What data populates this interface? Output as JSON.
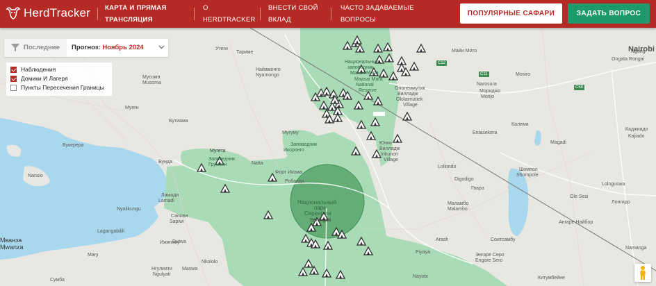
{
  "brand": {
    "name": "HerdTracker"
  },
  "nav": {
    "map_line1": "КАРТА И ПРЯМАЯ",
    "map_line2": "ТРАНСЛЯЦИЯ",
    "about_line1": "О",
    "about_line2": "HERDTRACKER",
    "contrib_line1": "ВНЕСТИ СВОЙ",
    "contrib_line2": "ВКЛАД",
    "faq_line1": "ЧАСТО ЗАДАВАЕМЫЕ",
    "faq_line2": "ВОПРОСЫ",
    "popular_button": "ПОПУЛЯРНЫЕ САФАРИ",
    "ask_button": "ЗАДАТЬ ВОПРОС"
  },
  "toolbar": {
    "recent_label": "Последние",
    "forecast_label": "Прогноз:",
    "forecast_value": "Ноябрь 2024"
  },
  "layers": [
    {
      "label": "Наблюдения",
      "checked": true
    },
    {
      "label": "Домики И Лагеря",
      "checked": true
    },
    {
      "label": "Пункты Пересечения Границы",
      "checked": false
    }
  ],
  "map_labels": {
    "utegi": "Утеги",
    "tarime": "Тариме",
    "nyamongo": "Найамонго",
    "nyamongo_en": "Nyamongo",
    "musoma": "Мусома",
    "musoma_en": "Musoma",
    "mugen": "Муген",
    "butiama": "Бутиама",
    "bukerera": "Букерера",
    "nansio": "Nansio",
    "bunda": "Бунда",
    "mugeta": "Мугета",
    "zapov_grumeti": "Заповедник",
    "grumeti": "Грумети",
    "natta": "Natta",
    "mugumu": "Мугуму",
    "zapov_ikorongo": "Заповедник",
    "ikorongo": "Икоронго",
    "fort_ikoma": "Форт Икома",
    "robanda": "Робанда",
    "masai_ru": "Национальный",
    "masai_ru2": "заповедник",
    "masai_ru3": "Масаи Мара",
    "masai_en": "Maasai Mara",
    "masai_en2": "National",
    "masai_en3": "Reserve",
    "olol_ru": "Олопеимутик",
    "olol_ru2": "Вилладж",
    "olol_en": "Ololaimutiek",
    "olol_en2": "Village",
    "mai_moto": "Майи Мото",
    "narosura": "Narosura",
    "morijo": "Мориджо",
    "morijo_en": "Morijo",
    "mosiro": "Mosiro",
    "entasekera": "Entasekera",
    "kalema": "Калема",
    "magadi": "Magadi",
    "nairobi": "Nairobi",
    "ngong": "Ngong",
    "ongata": "Ongata Rongai",
    "kajiado_ru": "Каджиадо",
    "kajiado": "Kajiado",
    "loliondo": "Loliondo",
    "shompole_ru": "Шомпол",
    "shompole": "Shompole",
    "digodigo": "Digodigo",
    "gwara": "Гвара",
    "lolnguswa": "Lolnguswa",
    "olesi": "Ole Sesi",
    "longido": "Лонгидо",
    "angare": "Ангаре Найбор",
    "malambo_ru": "Маламбо",
    "malambo": "Malambo",
    "lamadi": "Ламади",
    "lamadi_en": "Lamadi",
    "nyalikungu": "Nyalikungu",
    "sapiwi_ru": "Сапиви",
    "sapiwi": "Sapiwi",
    "lagangabilili": "Lagangabilili",
    "dutwa": "Dutwa",
    "mwanza": "Mwanza",
    "mary": "Mary",
    "busega": "Ижигиму",
    "nkololo": "Nkololo",
    "ngulyati_ru": "Нгулиати",
    "ngulyati": "Ngulyati",
    "sumba": "Сумба",
    "malya": "Маswa",
    "arash": "Arash",
    "piyaya": "Piyaya",
    "soitsambu": "Соитсамбу",
    "engaresero_ru": "Энгаре Серо",
    "engaresero": "Engare Sero",
    "nayobi": "Nayobi",
    "kitumbeine": "Китумбейне",
    "namanga": "Namanga",
    "serengeti_ru": "Национальный",
    "serengeti_ru2": "парк",
    "serengeti_ru3": "Серенгети",
    "serengeti_en": "Serengeti",
    "mwanza_ru": "Мванза",
    "yunki_ru": "Юнки",
    "yunki_ru2": "Вилладж",
    "yunki_en": "Inkunon",
    "yunki_en2": "Village",
    "kirumi": "Мвангена",
    "mbalageti": "Мбалагети",
    "kilimalutu": "Килима",
    "road_c12": "C12",
    "road_c11": "C11",
    "road_c58": "C58"
  }
}
